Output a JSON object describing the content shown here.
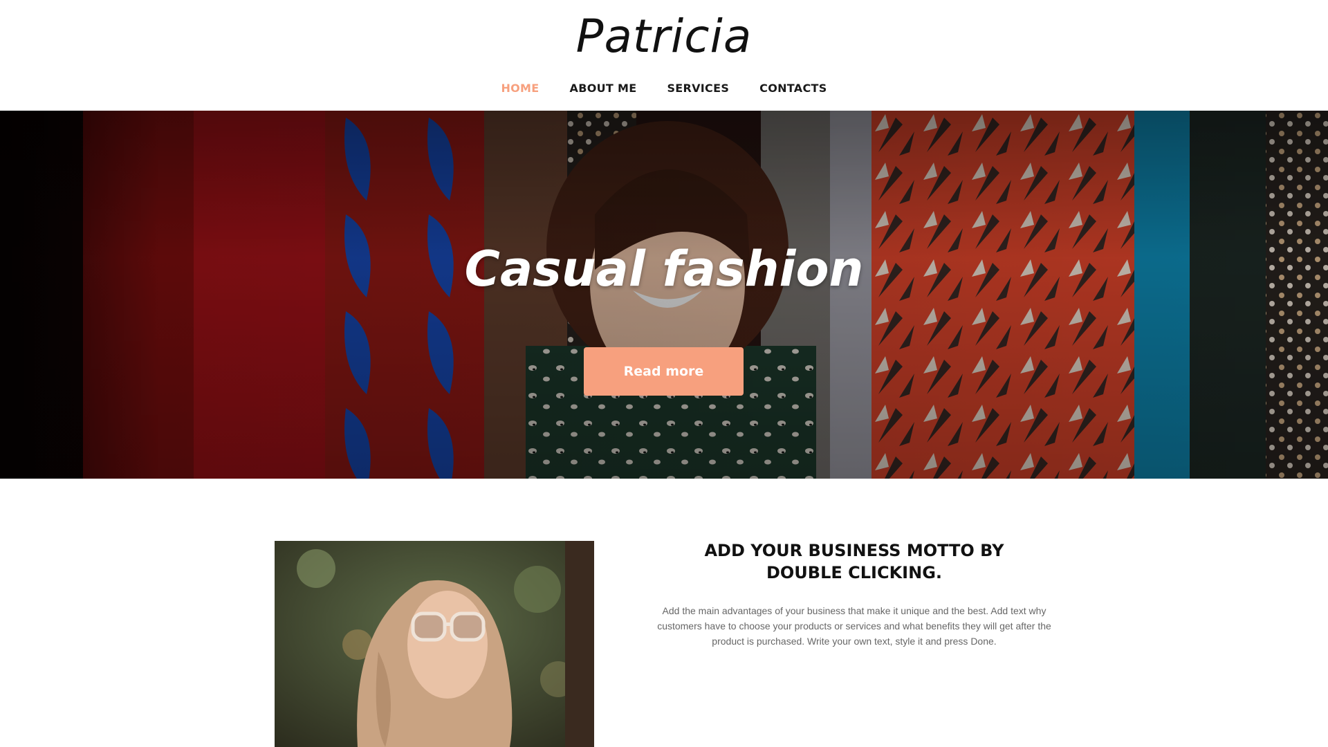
{
  "site": {
    "logo": "Patricia"
  },
  "nav": {
    "items": [
      {
        "label": "HOME",
        "active": true
      },
      {
        "label": "ABOUT ME",
        "active": false
      },
      {
        "label": "SERVICES",
        "active": false
      },
      {
        "label": "CONTACTS",
        "active": false
      }
    ]
  },
  "hero": {
    "title": "Casual fashion",
    "button_label": "Read more"
  },
  "about": {
    "motto": "ADD YOUR BUSINESS MOTTO BY DOUBLE CLICKING.",
    "description": "Add the main advantages of your business that make it unique and the best. Add text why customers have to choose your products or services and what benefits they will get after the product is purchased. Write your own text, style it and press Done."
  },
  "colors": {
    "accent": "#f7a07e",
    "text": "#111111",
    "muted": "#666666"
  }
}
